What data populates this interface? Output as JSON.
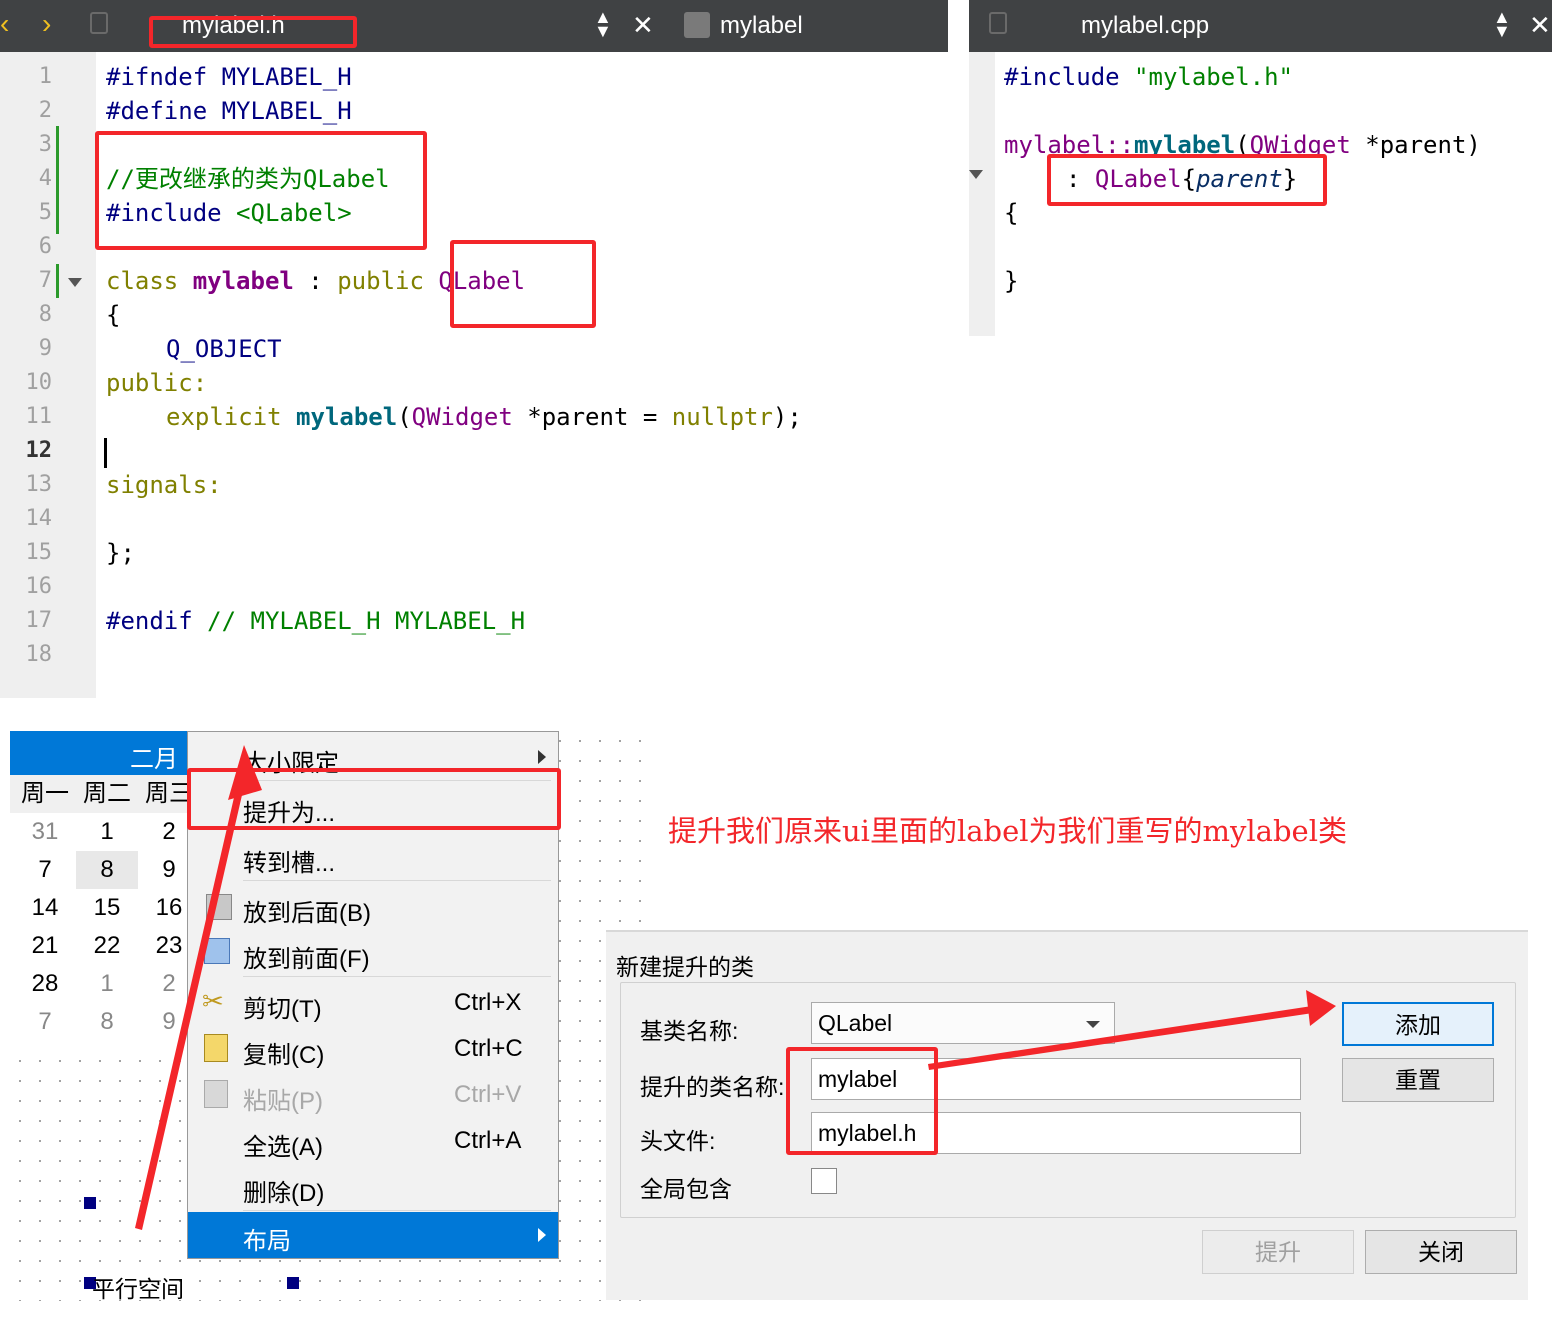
{
  "header_editor": {
    "tab_file": "mylabel.h",
    "tab_symbol": "mylabel",
    "line_numbers": [
      "1",
      "2",
      "3",
      "4",
      "5",
      "6",
      "7",
      "8",
      "9",
      "10",
      "11",
      "12",
      "13",
      "14",
      "15",
      "16",
      "17",
      "18"
    ]
  },
  "cpp_editor": {
    "tab_file": "mylabel.cpp"
  },
  "code_tokens": {
    "ifndef": "#ifndef",
    "define": "#define",
    "macro": "MYLABEL_H",
    "comment_cn": "//更改继承的类为QLabel",
    "include": "#include",
    "qlabel_hdr": "<QLabel>",
    "class": "class",
    "classname": "mylabel",
    "colon": " : ",
    "public": "public",
    "qlabel": "QLabel",
    "open_brace": "{",
    "qobject": "Q_OBJECT",
    "public_colon": "public:",
    "explicit": "explicit",
    "ctor": "mylabel",
    "qwidget": "QWidget",
    "param_default": " *parent = ",
    "nullptr": "nullptr",
    "close_call": ");",
    "signals": "signals:",
    "close_class": "};",
    "endif": "#endif",
    "endif_comment": "// MYLABEL_H",
    "cpp_include_str": "\"mylabel.h\"",
    "cpp_scope": "mylabel::",
    "cpp_param": " *parent)",
    "cpp_init_colon": ": ",
    "cpp_parent": "parent",
    "cpp_brace_open": "{",
    "cpp_brace_close": "}",
    "lbrace_inline": "{",
    "rbrace_inline": "}",
    "lparen": "("
  },
  "calendar": {
    "month": "二月",
    "weekdays": [
      "周一",
      "周二",
      "周三"
    ],
    "rows": [
      [
        "31",
        "1",
        "2"
      ],
      [
        "7",
        "8",
        "9"
      ],
      [
        "14",
        "15",
        "16"
      ],
      [
        "21",
        "22",
        "23"
      ],
      [
        "28",
        "1",
        "2"
      ],
      [
        "7",
        "8",
        "9"
      ]
    ]
  },
  "context_menu": {
    "size_limit": "大小限定",
    "promote": "提升为...",
    "goto_slot": "转到槽...",
    "send_back": "放到后面(B)",
    "bring_front": "放到前面(F)",
    "cut": "剪切(T)",
    "cut_sc": "Ctrl+X",
    "copy": "复制(C)",
    "copy_sc": "Ctrl+C",
    "paste": "粘贴(P)",
    "paste_sc": "Ctrl+V",
    "select_all": "全选(A)",
    "select_all_sc": "Ctrl+A",
    "delete": "删除(D)",
    "layout": "布局"
  },
  "spacer_label": "平行空间",
  "annotation": "提升我们原来ui里面的label为我们重写的mylabel类",
  "dialog": {
    "group_title": "新建提升的类",
    "base_class_label": "基类名称:",
    "base_class_value": "QLabel",
    "promoted_name_label": "提升的类名称:",
    "promoted_name_value": "mylabel",
    "header_label": "头文件:",
    "header_value": "mylabel.h",
    "global_include_label": "全局包含",
    "add_button": "添加",
    "reset_button": "重置",
    "promote_button": "提升",
    "close_button": "关闭"
  },
  "colors": {
    "annotation_red": "#f3262a",
    "menu_highlight": "#0078d7",
    "tabbar": "#404244"
  }
}
